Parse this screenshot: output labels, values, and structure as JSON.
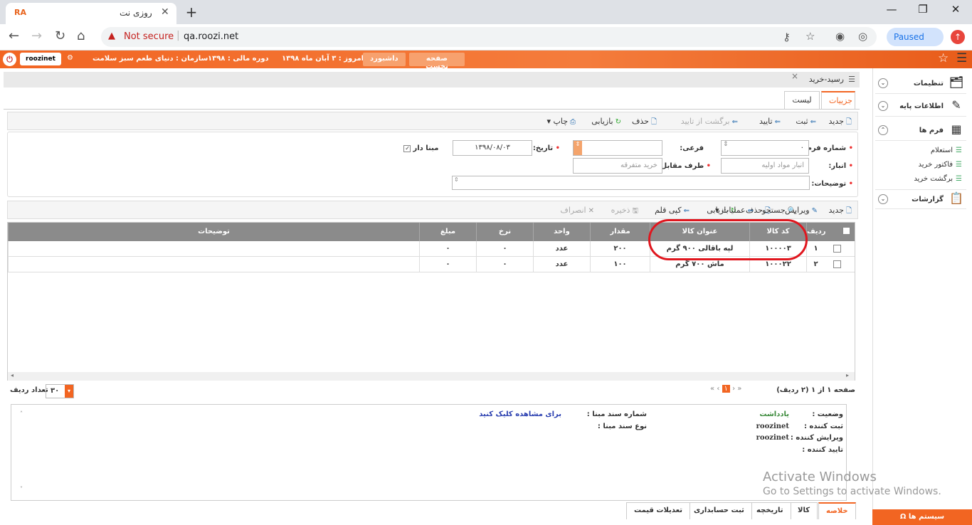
{
  "browser": {
    "tab_title": "روزی نت",
    "favicon_text": "RA",
    "url": "qa.roozi.net",
    "security": "Not secure",
    "profile": "Paused"
  },
  "topbar": {
    "user": "roozinet",
    "home_btn": "صفحه نخست",
    "dashboard_btn": "داشبورد",
    "today": "امروز : ۳ آبان ماه ۱۳۹۸",
    "fiscal": "دوره مالی : ۱۳۹۸",
    "org": "سازمان : دنیای طعم سبز سلامت"
  },
  "sidebar": {
    "items": [
      {
        "label": "تنظیمات",
        "icon": "settings-icon"
      },
      {
        "label": "اطلاعات پایه",
        "icon": "base-info-icon"
      },
      {
        "label": "فرم ها",
        "icon": "forms-icon"
      },
      {
        "label": "گزارشات",
        "icon": "reports-icon"
      }
    ],
    "sub": [
      "استعلام",
      "فاکتور خرید",
      "برگشت خرید"
    ],
    "systems": "سیستم ها"
  },
  "page": {
    "title": "رسید-خرید",
    "tabs": [
      "جزییات",
      "لیست"
    ]
  },
  "toolbar": {
    "new": "جدید",
    "register": "ثبت",
    "confirm": "تایید",
    "unconfirm": "برگشت از تایید",
    "delete": "حذف",
    "refresh": "بازیابی",
    "print": "چاپ"
  },
  "form": {
    "form_no_label": "شماره فرم:",
    "form_no": "۰",
    "sub_label": "فرعی:",
    "date_label": "تاریخ:",
    "date": "۱۳۹۸/۰۸/۰۳",
    "has_base": "مبنا دار",
    "warehouse_label": "انبار:",
    "warehouse": "انبار مواد اولیه",
    "party_label": "طرف مقابل:",
    "party": "خرید متفرقه",
    "desc_label": "توضیحات:"
  },
  "grid_toolbar": {
    "new": "جدید",
    "edit": "ویرایش",
    "delete": "حذف",
    "refresh": "بازیابی",
    "copy": "کپی قلم",
    "save": "ذخیره",
    "cancel": "انصراف",
    "search": "جستجو",
    "ops": "عملیات"
  },
  "grid": {
    "headers": {
      "row": "ردیف",
      "code": "کد کالا",
      "title": "عنوان کالا",
      "qty": "مقدار",
      "unit": "واحد",
      "rate": "نرخ",
      "amount": "مبلغ",
      "desc": "توضیحات"
    },
    "rows": [
      {
        "row": "۱",
        "code": "۱۰۰۰۰۳",
        "title": "لپه باقالی ۹۰۰ گرم",
        "qty": "۲۰۰",
        "unit": "عدد",
        "rate": "۰",
        "amount": "۰",
        "desc": ""
      },
      {
        "row": "۲",
        "code": "۱۰۰۰۲۲",
        "title": "ماش ۷۰۰ گرم",
        "qty": "۱۰۰",
        "unit": "عدد",
        "rate": "۰",
        "amount": "۰",
        "desc": ""
      }
    ]
  },
  "pager": {
    "summary": "صفحه ۱ از ۱ (۲ ردیف)",
    "page": "۱",
    "rows_label": "تعداد ردیف",
    "rows_value": "۳۰"
  },
  "info": {
    "status_label": "وضعیت :",
    "status": "یادداشت",
    "creator_label": "ثبت کننده :",
    "creator": "roozinet",
    "editor_label": "ویرایش کننده :",
    "editor": "roozinet",
    "approver_label": "تایید کننده :",
    "base_no_label": "شماره سند مبنا :",
    "base_no_link": "برای مشاهده کلیک کنید",
    "base_type_label": "نوع سند مبنا :"
  },
  "bottom_tabs": [
    "خلاصه",
    "کالا",
    "تاریخچه",
    "ثبت حسابداری",
    "تعدیلات قیمت"
  ],
  "watermark": {
    "line1": "Activate Windows",
    "line2": "Go to Settings to activate Windows."
  }
}
